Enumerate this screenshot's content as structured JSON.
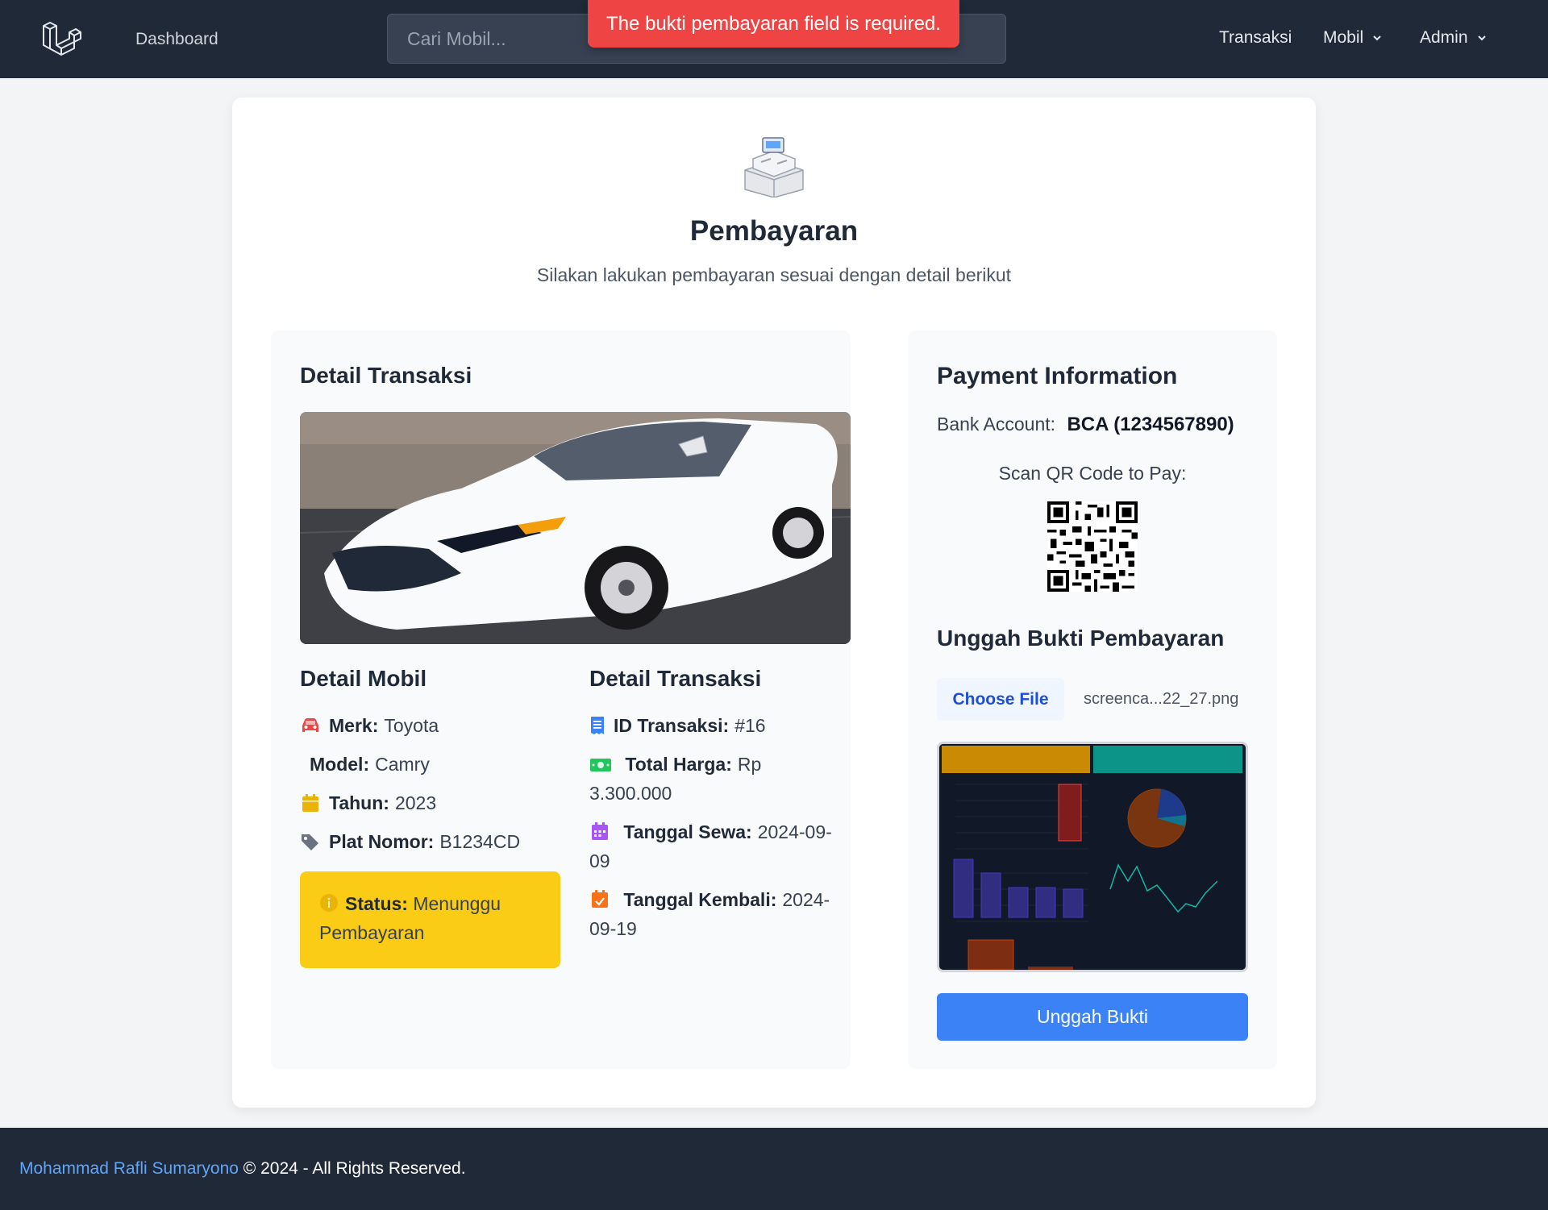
{
  "navbar": {
    "dashboard_label": "Dashboard",
    "search_placeholder": "Cari Mobil...",
    "links": [
      {
        "label": "Transaksi"
      },
      {
        "label": "Mobil"
      },
      {
        "label": "Admin"
      }
    ]
  },
  "toast": {
    "message": "The bukti pembayaran field is required.",
    "color": "#ef4444"
  },
  "header": {
    "title": "Pembayaran",
    "subtitle": "Silakan lakukan pembayaran sesuai dengan detail berikut"
  },
  "left_panel": {
    "title": "Detail Transaksi",
    "car": {
      "heading": "Detail Mobil",
      "merk_label": "Merk:",
      "merk": "Toyota",
      "model_label": "Model:",
      "model": "Camry",
      "tahun_label": "Tahun:",
      "tahun": "2023",
      "plat_label": "Plat Nomor:",
      "plat": "B1234CD",
      "status_label": "Status:",
      "status": "Menunggu Pembayaran"
    },
    "transaction": {
      "heading": "Detail Transaksi",
      "id_label": "ID Transaksi:",
      "id": "#16",
      "total_label": "Total Harga:",
      "total": "Rp 3.300.000",
      "sewa_label": "Tanggal Sewa:",
      "sewa": "2024-09-09",
      "kembali_label": "Tanggal Kembali:",
      "kembali": "2024-09-19"
    }
  },
  "right_panel": {
    "title": "Payment Information",
    "bank_label": "Bank Account:",
    "bank_value": "BCA (1234567890)",
    "qr_label": "Scan QR Code to Pay:",
    "upload_heading": "Unggah Bukti Pembayaran",
    "choose_file_label": "Choose File",
    "file_name": "screenca...22_27.png",
    "upload_button": "Unggah Bukti"
  },
  "footer": {
    "author": "Mohammad Rafli Sumaryono",
    "rights": " © 2024 - All Rights Reserved."
  },
  "colors": {
    "navbar_bg": "#1f2937",
    "primary": "#3b82f6",
    "status_bg": "#facc15",
    "author_link": "#60a5fa"
  },
  "icons": {
    "logo": "laravel-logo-icon",
    "header": "cash-register-icon",
    "merk": "car-icon",
    "tahun": "calendar-icon",
    "plat": "tag-icon",
    "status": "info-circle-icon",
    "id": "receipt-icon",
    "total": "money-bill-icon",
    "sewa": "calendar-days-icon",
    "kembali": "calendar-check-icon"
  }
}
